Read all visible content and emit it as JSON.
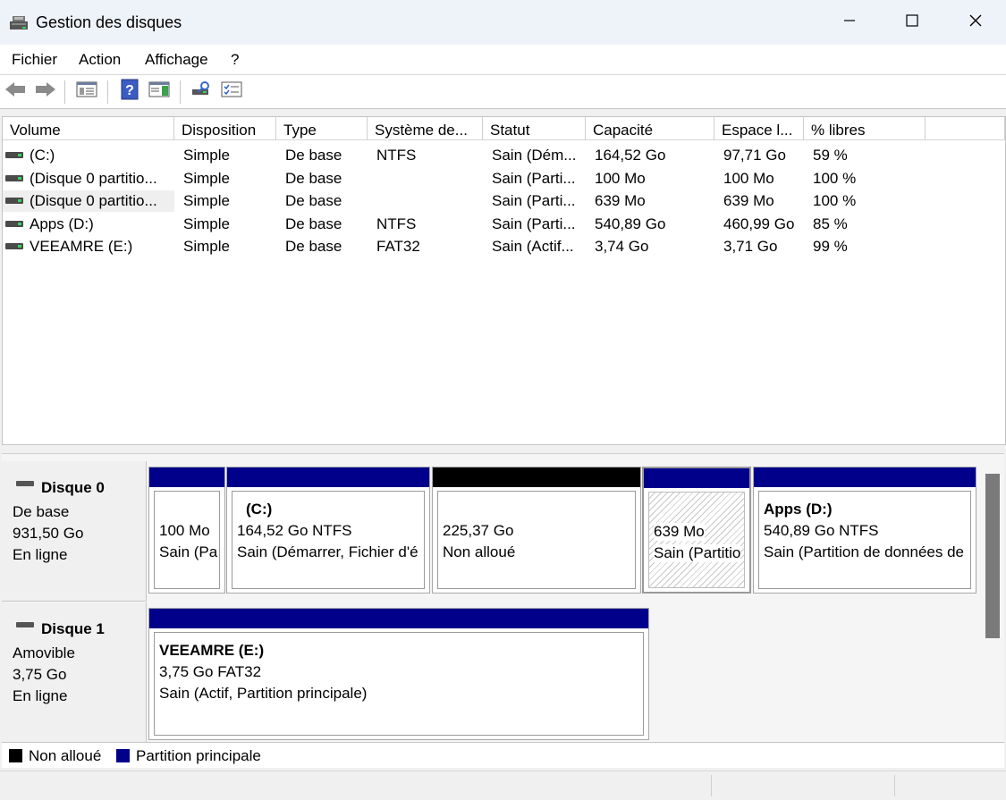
{
  "window": {
    "title": "Gestion des disques",
    "minimize_icon": "minimize-icon",
    "maximize_icon": "maximize-icon",
    "close_icon": "close-icon"
  },
  "menu": [
    "Fichier",
    "Action",
    "Affichage",
    "?"
  ],
  "table": {
    "columns": [
      "Volume",
      "Disposition",
      "Type",
      "Système de...",
      "Statut",
      "Capacité",
      "Espace l...",
      "% libres"
    ],
    "rows": [
      [
        "(C:)",
        "Simple",
        "De base",
        "NTFS",
        "Sain (Dém...",
        "164,52 Go",
        "97,71 Go",
        "59 %"
      ],
      [
        "(Disque 0 partitio...",
        "Simple",
        "De base",
        "",
        "Sain (Parti...",
        "100 Mo",
        "100 Mo",
        "100 %"
      ],
      [
        "(Disque 0 partitio...",
        "Simple",
        "De base",
        "",
        "Sain (Parti...",
        "639 Mo",
        "639 Mo",
        "100 %"
      ],
      [
        "Apps (D:)",
        "Simple",
        "De base",
        "NTFS",
        "Sain (Parti...",
        "540,89 Go",
        "460,99 Go",
        "85 %"
      ],
      [
        "VEEAMRE (E:)",
        "Simple",
        "De base",
        "FAT32",
        "Sain (Actif...",
        "3,74 Go",
        "3,71 Go",
        "99 %"
      ]
    ]
  },
  "disks": [
    {
      "name": "Disque 0",
      "type": "De base",
      "size": "931,50 Go",
      "state": "En ligne",
      "partitions": [
        {
          "title": "",
          "size": "100 Mo",
          "status": "Sain (Pa"
        },
        {
          "title": "(C:)",
          "size": "164,52 Go NTFS",
          "status": "Sain (Démarrer, Fichier d'é"
        },
        {
          "title": "",
          "size": "225,37 Go",
          "status": "Non alloué"
        },
        {
          "title": "",
          "size": "639 Mo",
          "status": "Sain (Partitio"
        },
        {
          "title": "Apps  (D:)",
          "size": "540,89 Go NTFS",
          "status": "Sain (Partition de données de"
        }
      ]
    },
    {
      "name": "Disque 1",
      "type": "Amovible",
      "size": "3,75 Go",
      "state": "En ligne",
      "partitions": [
        {
          "title": "VEEAMRE  (E:)",
          "size": "3,75 Go FAT32",
          "status": "Sain (Actif, Partition principale)"
        }
      ]
    }
  ],
  "legend": {
    "unallocated": "Non alloué",
    "primary": "Partition principale"
  },
  "colors": {
    "primary": "#00008b",
    "unallocated": "#000000",
    "accent": "#39d060"
  }
}
